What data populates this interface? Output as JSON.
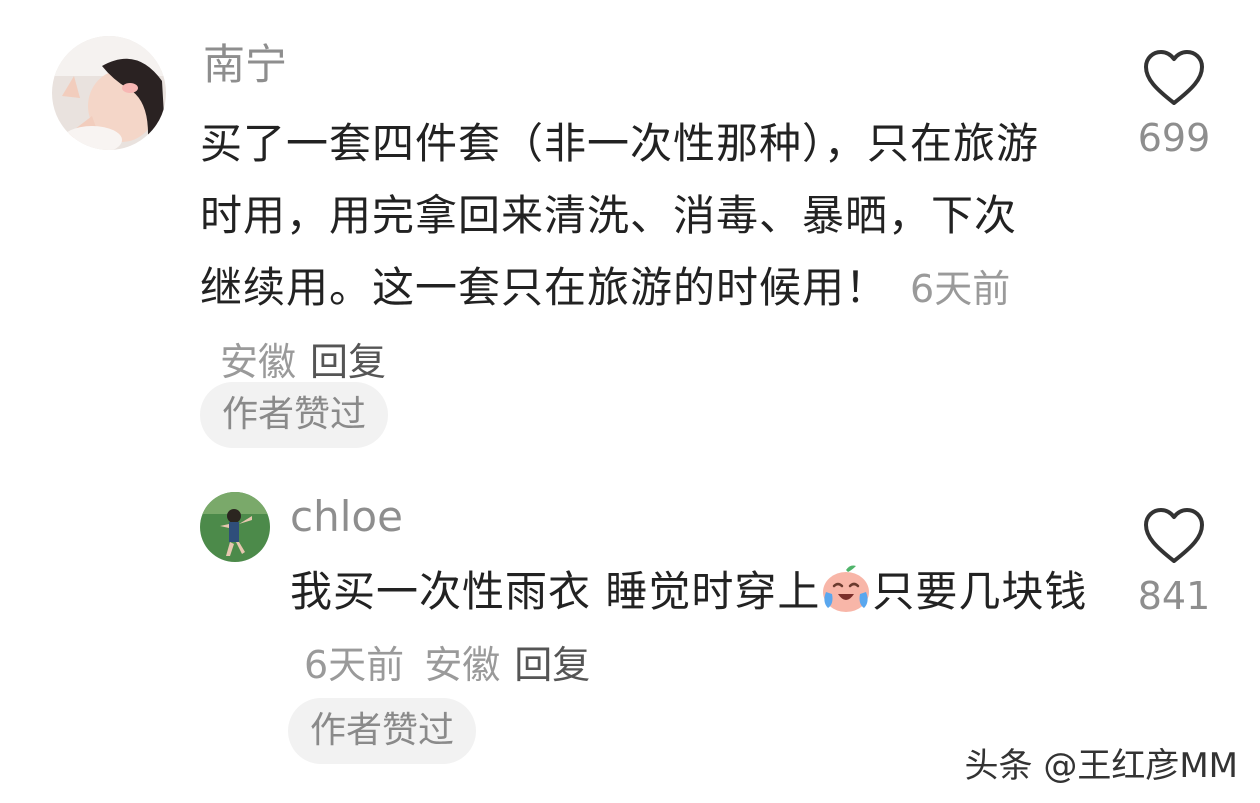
{
  "comments": [
    {
      "author": "南宁",
      "text": "买了一套四件套（非一次性那种），只在旅游时用，用完拿回来清洗、消毒、暴晒，下次继续用。这一套只在旅游的时候用！",
      "time": "6天前",
      "location": "安徽",
      "reply_label": "回复",
      "badge": "作者赞过",
      "like_count": "699",
      "like_icon": "heart-outline-icon"
    },
    {
      "author": "chloe",
      "text_before_emoji": "我买一次性雨衣 睡觉时穿上",
      "emoji": "crying-laughing-emoji",
      "text_after_emoji": "只要几块钱",
      "time": "6天前",
      "location": "安徽",
      "reply_label": "回复",
      "badge": "作者赞过",
      "like_count": "841",
      "like_icon": "heart-outline-icon"
    }
  ],
  "watermark": "头条 @王红彦MM",
  "colors": {
    "background": "#ffffff",
    "name": "#8e8e8e",
    "text": "#222222",
    "meta": "#9a9a9a",
    "badge_bg": "#f2f2f2"
  }
}
